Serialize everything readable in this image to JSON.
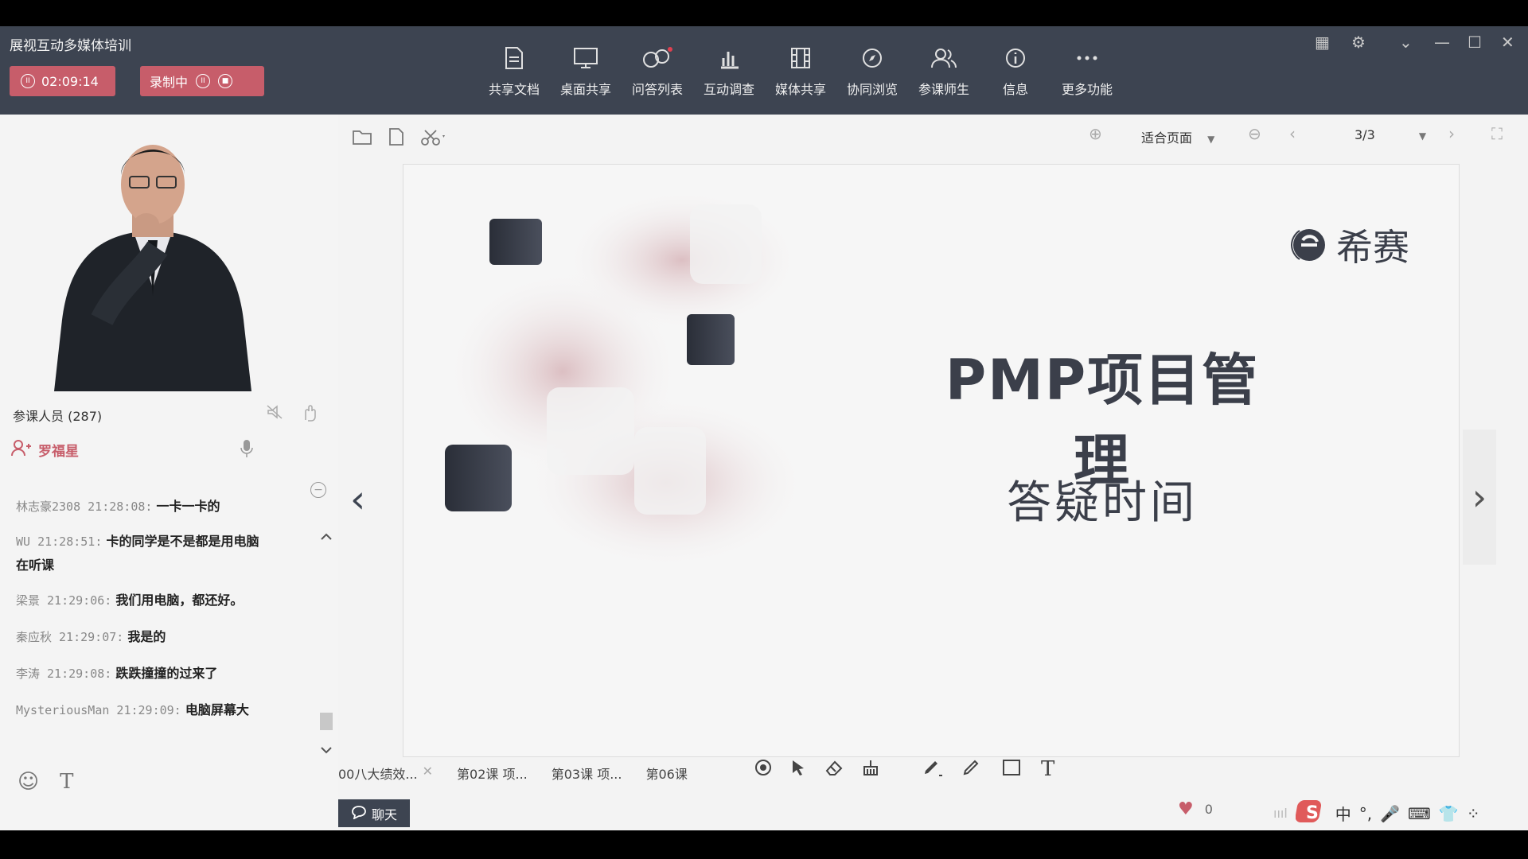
{
  "app": {
    "title": "展视互动多媒体培训"
  },
  "session": {
    "timer": "02:09:14",
    "recording_label": "录制中"
  },
  "toolbar": {
    "items": [
      {
        "label": "共享文档",
        "icon": "document-share-icon"
      },
      {
        "label": "桌面共享",
        "icon": "desktop-share-icon"
      },
      {
        "label": "问答列表",
        "icon": "qa-list-icon"
      },
      {
        "label": "互动调查",
        "icon": "survey-chart-icon"
      },
      {
        "label": "媒体共享",
        "icon": "media-share-icon"
      },
      {
        "label": "协同浏览",
        "icon": "compass-icon"
      },
      {
        "label": "参课师生",
        "icon": "participants-icon"
      },
      {
        "label": "信息",
        "icon": "info-icon"
      },
      {
        "label": "更多功能",
        "icon": "more-icon"
      }
    ]
  },
  "attendees": {
    "label": "参课人员 (287)",
    "speaker": "罗福星"
  },
  "chat": {
    "messages": [
      {
        "name": "林志豪2308 21:28:08:",
        "text": "一卡一卡的"
      },
      {
        "name": "WU 21:28:51:",
        "text": "卡的同学是不是都是用电脑",
        "text2": "在听课"
      },
      {
        "name": "梁景 21:29:06:",
        "text": "我们用电脑，都还好。"
      },
      {
        "name": "秦应秋 21:29:07:",
        "text": "我是的"
      },
      {
        "name": "李涛 21:29:08:",
        "text": "跌跌撞撞的过来了"
      },
      {
        "name": "MysteriousMan 21:29:09:",
        "text": "电脑屏幕大"
      }
    ],
    "tab_label": "聊天"
  },
  "doc": {
    "zoom_label": "适合页面",
    "page": "3/3",
    "tabs": [
      "00八大绩效...",
      "第02课 项...",
      "第03课 项...",
      "第06课"
    ]
  },
  "slide": {
    "title": "PMP项目管理",
    "subtitle": "答疑时间",
    "logo_text": "希赛"
  },
  "status": {
    "likes": "0",
    "ime_lang": "中"
  }
}
